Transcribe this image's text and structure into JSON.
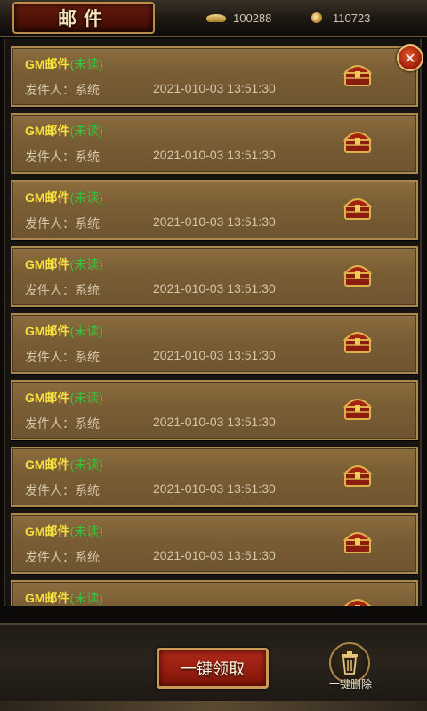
{
  "header": {
    "title": "邮件",
    "currency_1": {
      "icon": "gold-ingot-icon",
      "amount": "100288"
    },
    "currency_2": {
      "icon": "coin-icon",
      "amount": "110723"
    }
  },
  "mails": [
    {
      "subject": "GM邮件",
      "status": "(未读)",
      "sender": "发件人：系统",
      "date": "2021-010-03 13:51:30",
      "icon": "treasure-chest-icon"
    },
    {
      "subject": "GM邮件",
      "status": "(未读)",
      "sender": "发件人：系统",
      "date": "2021-010-03 13:51:30",
      "icon": "treasure-chest-icon"
    },
    {
      "subject": "GM邮件",
      "status": "(未读)",
      "sender": "发件人：系统",
      "date": "2021-010-03 13:51:30",
      "icon": "treasure-chest-icon"
    },
    {
      "subject": "GM邮件",
      "status": "(未读)",
      "sender": "发件人：系统",
      "date": "2021-010-03 13:51:30",
      "icon": "treasure-chest-icon"
    },
    {
      "subject": "GM邮件",
      "status": "(未读)",
      "sender": "发件人：系统",
      "date": "2021-010-03 13:51:30",
      "icon": "treasure-chest-icon"
    },
    {
      "subject": "GM邮件",
      "status": "(未读)",
      "sender": "发件人：系统",
      "date": "2021-010-03 13:51:30",
      "icon": "treasure-chest-icon"
    },
    {
      "subject": "GM邮件",
      "status": "(未读)",
      "sender": "发件人：系统",
      "date": "2021-010-03 13:51:30",
      "icon": "treasure-chest-icon"
    },
    {
      "subject": "GM邮件",
      "status": "(未读)",
      "sender": "发件人：系统",
      "date": "2021-010-03 13:51:30",
      "icon": "treasure-chest-icon"
    },
    {
      "subject": "GM邮件",
      "status": "(未读)",
      "sender": "",
      "date": "",
      "icon": "treasure-chest-icon"
    }
  ],
  "footer": {
    "claim_all_label": "一键领取",
    "delete_all_label": "一键删除"
  },
  "colors": {
    "subject": "#f7e040",
    "unread_status": "#38c63a",
    "claim_button": "#b22a1a"
  }
}
